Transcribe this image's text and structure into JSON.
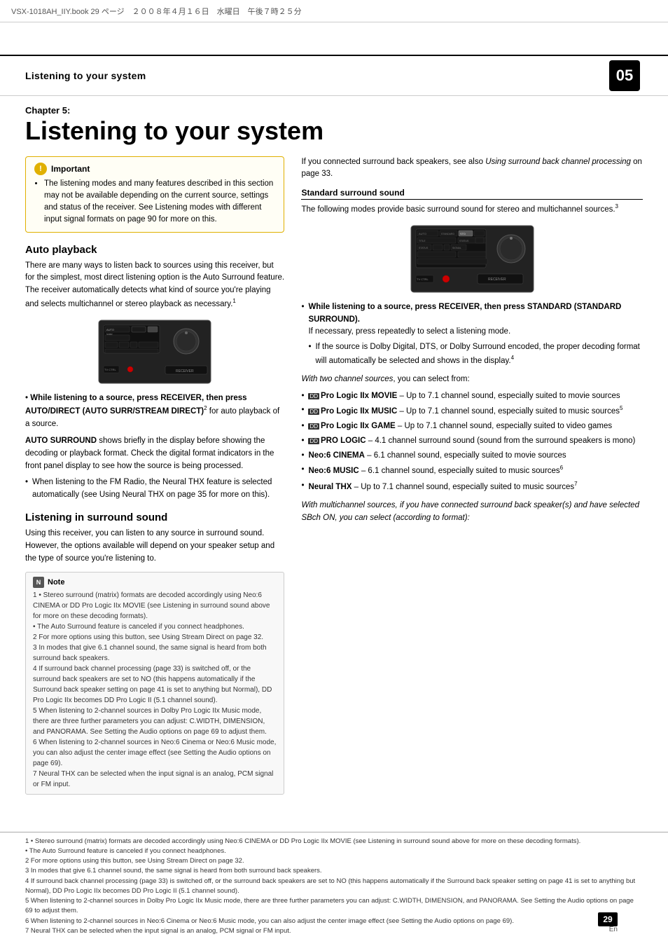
{
  "header": {
    "file_info": "VSX-1018AH_IIY.book  29 ページ　２００８年４月１６日　水曜日　午後７時２５分"
  },
  "chapter_header": {
    "title": "Listening to your system",
    "number": "05"
  },
  "chapter": {
    "label": "Chapter 5:",
    "main_title": "Listening to your system"
  },
  "important": {
    "title": "Important",
    "bullet": "The listening modes and many features described in this section may not be available depending on the current source, settings and status of the receiver. See Listening modes with different input signal formats on page 90 for more on this."
  },
  "auto_playback": {
    "heading": "Auto playback",
    "body": "There are many ways to listen back to sources using this receiver, but for the simplest, most direct listening option is the Auto Surround feature. The receiver automatically detects what kind of source you're playing and selects multichannel or stereo playback as necessary.",
    "footnote_ref": "1",
    "instruction_bold": "While listening to a source, press RECEIVER, then press AUTO/DIRECT (AUTO SURR/STREAM DIRECT)",
    "instruction_footnote": "2",
    "instruction_suffix": " for auto playback of a source.",
    "auto_surround_label": "AUTO SURROUND",
    "auto_surround_body": " shows briefly in the display before showing the decoding or playback format. Check the digital format indicators in the front panel display to see how the source is being processed.",
    "note_bullet": "When listening to the FM Radio, the Neural THX feature is selected automatically (see Using Neural THX on page 35 for more on this)."
  },
  "surround_sound": {
    "heading": "Listening in surround sound",
    "body": "Using this receiver, you can listen to any source in surround sound. However, the options available will depend on your speaker setup and the type of source you're listening to."
  },
  "standard_surround": {
    "heading": "Standard surround sound",
    "body": "The following modes provide basic surround sound for stereo and multichannel sources.",
    "footnote_ref": "3",
    "instruction_bold": "While listening to a source, press RECEIVER, then press STANDARD (STANDARD SURROUND).",
    "instruction_body": "If necessary, press repeatedly to select a listening mode.",
    "sub_bullet1": "If the source is Dolby Digital, DTS, or Dolby Surround encoded, the proper decoding format will automatically be selected and shows in the display.",
    "sub_footnote": "4",
    "two_channel_label": "With two channel sources",
    "two_channel_suffix": ", you can select from:",
    "options": [
      {
        "icon": "DD",
        "label": "Pro Logic IIx MOVIE",
        "body": "– Up to 7.1 channel sound, especially suited to movie sources"
      },
      {
        "icon": "DD",
        "label": "Pro Logic IIx MUSIC",
        "body": "– Up to 7.1 channel sound, especially suited to music sources",
        "footnote": "5"
      },
      {
        "icon": "DD",
        "label": "Pro Logic IIx GAME",
        "body": "– Up to 7.1 channel sound, especially suited to video games"
      },
      {
        "icon": "DD",
        "label": "PRO LOGIC",
        "body": "– 4.1 channel surround sound (sound from the surround speakers is mono)"
      },
      {
        "label": "Neo:6 CINEMA",
        "body": "– 6.1 channel sound, especially suited to movie sources"
      },
      {
        "label": "Neo:6 MUSIC",
        "body": "– 6.1 channel sound, especially suited to music sources",
        "footnote": "6"
      },
      {
        "label": "Neural THX",
        "body": "– Up to 7.1 channel sound, especially suited to music sources",
        "footnote": "7"
      }
    ],
    "multichannel_italic": "With multichannel sources, if you have connected surround back speaker(s) and have selected SBch ON, you can select (according to format):"
  },
  "note": {
    "title": "Note",
    "lines": [
      "1 • Stereo surround (matrix) formats are decoded accordingly using Neo:6 CINEMA or DD Pro Logic IIx MOVIE (see Listening in surround sound above for more on these decoding formats).",
      "• The Auto Surround feature is canceled if you connect headphones.",
      "2 For more options using this button, see Using Stream Direct on page 32.",
      "3 In modes that give 6.1 channel sound, the same signal is heard from both surround back speakers.",
      "4 If surround back channel processing (page 33) is switched off, or the surround back speakers are set to NO (this happens automatically if the Surround back speaker setting on page 41 is set to anything but Normal), DD Pro Logic IIx becomes DD Pro Logic II (5.1 channel sound).",
      "5 When listening to 2-channel sources in Dolby Pro Logic IIx Music mode, there are three further parameters you can adjust: C.WIDTH, DIMENSION, and PANORAMA. See Setting the Audio options on page 69 to adjust them.",
      "6 When listening to 2-channel sources in Neo:6 Cinema or Neo:6 Music mode, you can also adjust the center image effect (see Setting the Audio options on page 69).",
      "7 Neural THX can be selected when the input signal is an analog, PCM signal or FM input."
    ]
  },
  "page": {
    "number": "29",
    "lang": "En"
  }
}
